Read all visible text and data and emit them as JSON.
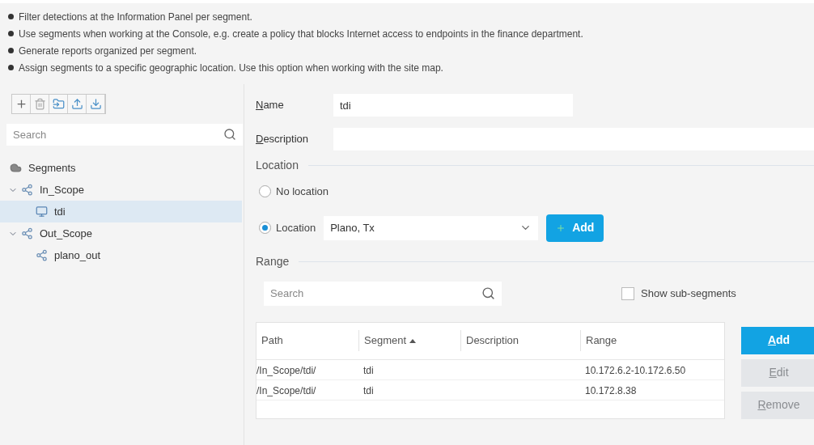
{
  "bullets": [
    "Filter detections at the Information Panel per segment.",
    "Use segments when working at the Console, e.g. create a policy that blocks Internet access to endpoints in the finance department.",
    "Generate reports organized per segment.",
    "Assign segments to a specific geographic location. Use this option when working with the site map."
  ],
  "toolbar": [
    {
      "kind": "add"
    },
    {
      "kind": "delete"
    },
    {
      "kind": "move"
    },
    {
      "kind": "export"
    },
    {
      "kind": "import"
    }
  ],
  "tree_search": {
    "placeholder": "Search"
  },
  "tree": {
    "label": "Segments",
    "children": [
      {
        "label": "In_Scope",
        "expanded": true,
        "selected": false,
        "kind": "segment",
        "children": [
          {
            "label": "tdi",
            "selected": true,
            "kind": "endpoint"
          }
        ]
      },
      {
        "label": "Out_Scope",
        "expanded": true,
        "selected": false,
        "kind": "segment",
        "children": [
          {
            "label": "plano_out",
            "selected": false,
            "kind": "segment"
          }
        ]
      }
    ]
  },
  "form": {
    "name_label": "Name",
    "name_value": "tdi",
    "description_label": "Description"
  },
  "location": {
    "heading": "Location",
    "options": [
      {
        "label": "No location",
        "selected": false
      },
      {
        "label": "Location",
        "selected": true
      }
    ],
    "value": "Plano, Tx",
    "add_button": "Add"
  },
  "range": {
    "heading": "Range",
    "search": {
      "placeholder": "Search"
    },
    "show_sub_segments": {
      "label": "Show sub-segments",
      "checked": false
    },
    "columns": [
      {
        "label": "Path",
        "sorted": false
      },
      {
        "label": "Segment",
        "sorted": true
      },
      {
        "label": "Description",
        "sorted": false
      },
      {
        "label": "Range",
        "sorted": false
      }
    ],
    "rows": [
      [
        "/In_Scope/tdi/",
        "tdi",
        "",
        "10.172.6.2-10.172.6.50"
      ],
      [
        "/In_Scope/tdi/",
        "tdi",
        "",
        "10.172.8.38"
      ]
    ],
    "buttons": [
      {
        "label": "Add",
        "disabled": false
      },
      {
        "label": "Edit",
        "disabled": true
      },
      {
        "label": "Remove",
        "disabled": true
      }
    ]
  }
}
